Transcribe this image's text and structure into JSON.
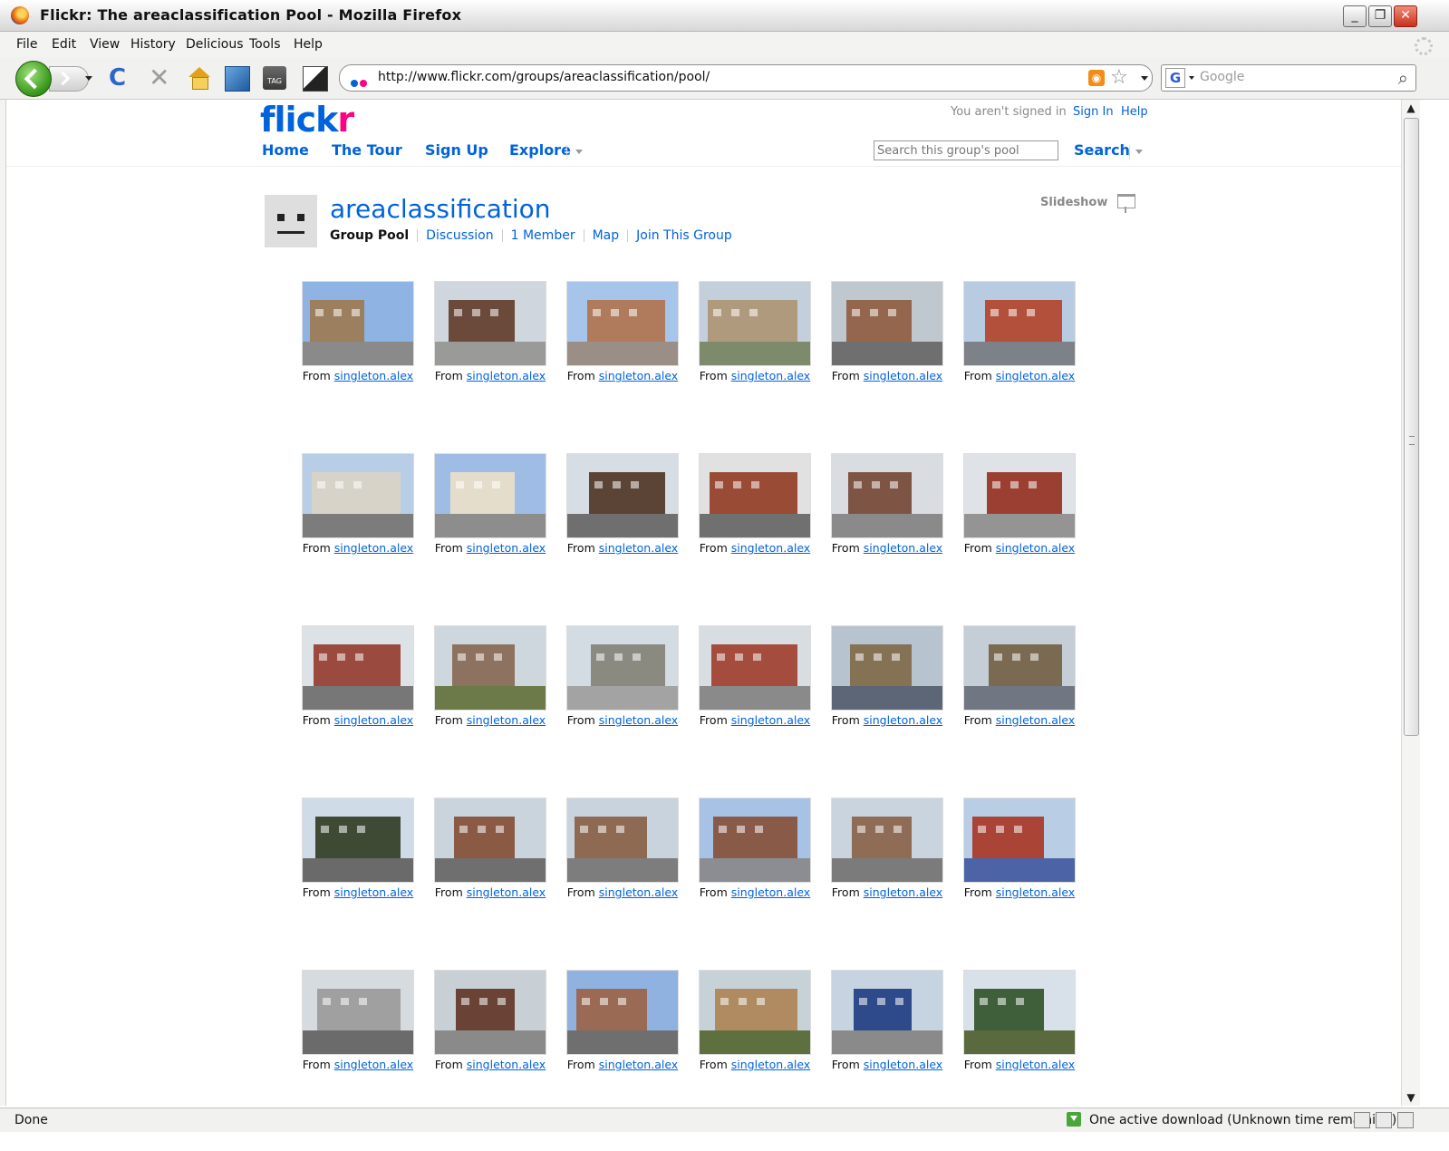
{
  "window": {
    "title": "Flickr: The areaclassification Pool - Mozilla Firefox",
    "controls": [
      "_",
      "❐",
      "✕"
    ]
  },
  "menu": [
    "File",
    "Edit",
    "View",
    "History",
    "Delicious",
    "Tools",
    "Help"
  ],
  "toolbar": {
    "url": "http://www.flickr.com/groups/areaclassification/pool/",
    "search_engine_placeholder": "Google"
  },
  "status": {
    "left": "Done",
    "download": "One active download (Unknown time remaining)"
  },
  "flickr": {
    "logo_main": "flick",
    "logo_accent": "r",
    "nav": [
      "Home",
      "The Tour",
      "Sign Up",
      "Explore"
    ],
    "sign_status": "You aren't signed in",
    "sign_in": "Sign In",
    "help": "Help",
    "pool_search_placeholder": "Search this group's pool",
    "search_label": "Search"
  },
  "group": {
    "name": "areaclassification",
    "current_tab": "Group Pool",
    "tabs": [
      "Discussion",
      "1 Member",
      "Map",
      "Join This Group"
    ],
    "slideshow": "Slideshow"
  },
  "pool": {
    "from_label": "From",
    "photos": [
      {
        "owner": "singleton.alex",
        "sky": "#8fb3e3",
        "building": "#9c7f5e",
        "road": "#8a8a8a"
      },
      {
        "owner": "singleton.alex",
        "sky": "#cfd6dd",
        "building": "#6b4a3b",
        "road": "#9a9a98"
      },
      {
        "owner": "singleton.alex",
        "sky": "#a7c4ea",
        "building": "#b07a5c",
        "road": "#9b8e86"
      },
      {
        "owner": "singleton.alex",
        "sky": "#c3d0dc",
        "building": "#b09a7e",
        "road": "#7e8a6c"
      },
      {
        "owner": "singleton.alex",
        "sky": "#bfc8cf",
        "building": "#93664d",
        "road": "#6f6f6f"
      },
      {
        "owner": "singleton.alex",
        "sky": "#b9cbe0",
        "building": "#b3503c",
        "road": "#7d8288"
      },
      {
        "owner": "singleton.alex",
        "sky": "#b8cde6",
        "building": "#d8d3c8",
        "road": "#7c7c7c"
      },
      {
        "owner": "singleton.alex",
        "sky": "#9fbde4",
        "building": "#e4ddcc",
        "road": "#8d8d8d"
      },
      {
        "owner": "singleton.alex",
        "sky": "#d6dde4",
        "building": "#5b4436",
        "road": "#6f6f6f"
      },
      {
        "owner": "singleton.alex",
        "sky": "#e1e1e1",
        "building": "#9a4b36",
        "road": "#707070"
      },
      {
        "owner": "singleton.alex",
        "sky": "#d9dde1",
        "building": "#7e5445",
        "road": "#8a8a8a"
      },
      {
        "owner": "singleton.alex",
        "sky": "#dfe3e8",
        "building": "#9b3f33",
        "road": "#949494"
      },
      {
        "owner": "singleton.alex",
        "sky": "#dde2e6",
        "building": "#9a4a3e",
        "road": "#777777"
      },
      {
        "owner": "singleton.alex",
        "sky": "#cfd7de",
        "building": "#8e7260",
        "road": "#6b7a48"
      },
      {
        "owner": "singleton.alex",
        "sky": "#d3dbe3",
        "building": "#8a8a80",
        "road": "#a3a3a3"
      },
      {
        "owner": "singleton.alex",
        "sky": "#d8dde2",
        "building": "#a44c3e",
        "road": "#8a8a8a"
      },
      {
        "owner": "singleton.alex",
        "sky": "#b7c4cf",
        "building": "#857154",
        "road": "#5d6677"
      },
      {
        "owner": "singleton.alex",
        "sky": "#c5ced6",
        "building": "#7a6a52",
        "road": "#707682"
      },
      {
        "owner": "singleton.alex",
        "sky": "#cfdbe6",
        "building": "#3f4a35",
        "road": "#6a6a6a"
      },
      {
        "owner": "singleton.alex",
        "sky": "#c9d4dd",
        "building": "#8a5a45",
        "road": "#6f6f6f"
      },
      {
        "owner": "singleton.alex",
        "sky": "#c9d3de",
        "building": "#8f6a52",
        "road": "#7d7d7d"
      },
      {
        "owner": "singleton.alex",
        "sky": "#a8c2e6",
        "building": "#8a5a48",
        "road": "#8b8d92"
      },
      {
        "owner": "singleton.alex",
        "sky": "#cad4de",
        "building": "#8e6c55",
        "road": "#7b7b7b"
      },
      {
        "owner": "singleton.alex",
        "sky": "#b9cde5",
        "building": "#a94437",
        "road": "#4c63a6"
      },
      {
        "owner": "singleton.alex",
        "sky": "#d6dbe0",
        "building": "#a0a0a0",
        "road": "#6b6b6b"
      },
      {
        "owner": "singleton.alex",
        "sky": "#c8cfd5",
        "building": "#6a4236",
        "road": "#8a8a8a"
      },
      {
        "owner": "singleton.alex",
        "sky": "#8fb2e0",
        "building": "#9b6a55",
        "road": "#6f6f6f"
      },
      {
        "owner": "singleton.alex",
        "sky": "#c6d1d8",
        "building": "#b08a60",
        "road": "#5e7040"
      },
      {
        "owner": "singleton.alex",
        "sky": "#c6d4e2",
        "building": "#2f4a8a",
        "road": "#8a8a8a"
      },
      {
        "owner": "singleton.alex",
        "sky": "#d8e1ea",
        "building": "#3f5e3a",
        "road": "#5a6a3e"
      }
    ]
  }
}
